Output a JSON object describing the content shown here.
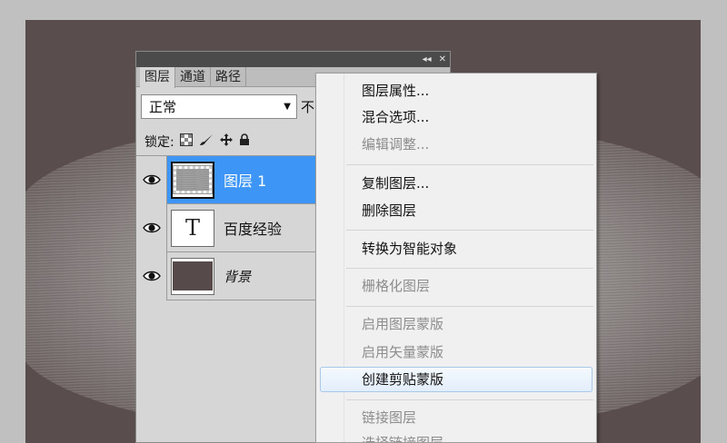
{
  "panel": {
    "titlebar": {
      "collapse_glyph": "◂◂",
      "close_glyph": "✕"
    },
    "tabs": [
      {
        "label": "图层",
        "active": true
      },
      {
        "label": "通道",
        "active": false
      },
      {
        "label": "路径",
        "active": false
      }
    ],
    "blend_mode": "正常",
    "opacity_label_partial": "不",
    "lock_label": "锁定:",
    "lock_icons": [
      "transparency-lock-icon",
      "brush-lock-icon",
      "move-lock-icon",
      "padlock-icon"
    ],
    "layers": [
      {
        "name": "图层 1",
        "type": "raster",
        "selected": true
      },
      {
        "name": "百度经验",
        "type": "text",
        "thumb_glyph": "T",
        "selected": false
      },
      {
        "name": "背景",
        "type": "background",
        "selected": false
      }
    ]
  },
  "menu": {
    "items": [
      {
        "label": "图层属性...",
        "disabled": false
      },
      {
        "label": "混合选项...",
        "disabled": false
      },
      {
        "label": "编辑调整...",
        "disabled": true
      },
      {
        "label": "复制图层...",
        "disabled": false
      },
      {
        "label": "删除图层",
        "disabled": false
      },
      {
        "label": "转换为智能对象",
        "disabled": false
      },
      {
        "label": "栅格化图层",
        "disabled": true
      },
      {
        "label": "启用图层蒙版",
        "disabled": true
      },
      {
        "label": "启用矢量蒙版",
        "disabled": true
      },
      {
        "label": "创建剪贴蒙版",
        "disabled": false,
        "highlighted": true
      },
      {
        "label": "链接图层",
        "disabled": true
      },
      {
        "label": "选择链接图层",
        "disabled": true
      }
    ]
  },
  "colors": {
    "canvas_bg": "#5a4d4d",
    "selection_blue": "#3d96f5",
    "menu_bg": "#f0f0f0",
    "disabled_text": "#8d8d8d"
  }
}
